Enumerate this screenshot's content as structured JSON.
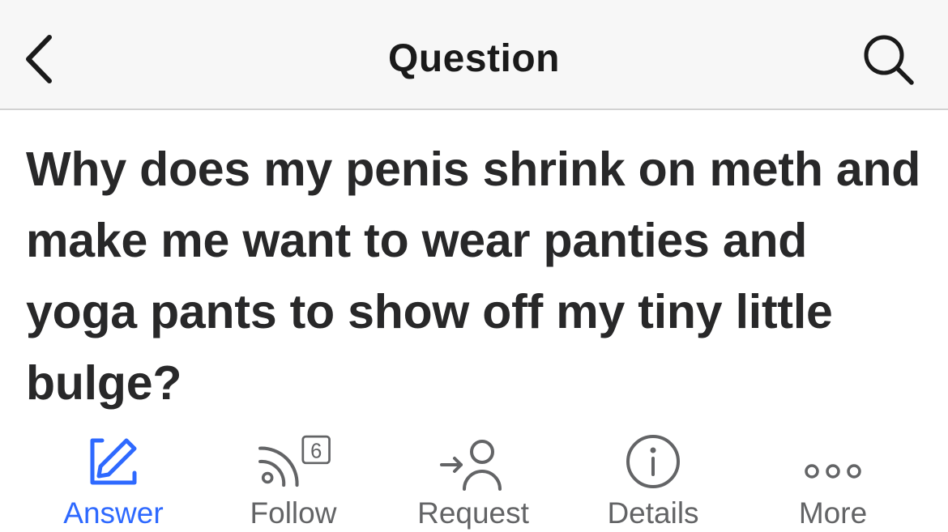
{
  "header": {
    "title": "Question",
    "back_icon": "chevron-left-icon",
    "search_icon": "search-icon"
  },
  "question": {
    "title": "Why does my penis shrink on meth and make me want to wear panties and yoga pants to show off my tiny little bulge?"
  },
  "actions": [
    {
      "label": "Answer",
      "icon": "pencil-edit-icon",
      "active": true
    },
    {
      "label": "Follow",
      "icon": "rss-feed-icon",
      "badge": "6"
    },
    {
      "label": "Request",
      "icon": "request-user-icon"
    },
    {
      "label": "Details",
      "icon": "info-icon"
    },
    {
      "label": "More",
      "icon": "more-dots-icon"
    }
  ],
  "colors": {
    "accent": "#2e69ff",
    "text": "#282829",
    "icon_gray": "#636466",
    "header_bg": "#f7f7f7"
  }
}
